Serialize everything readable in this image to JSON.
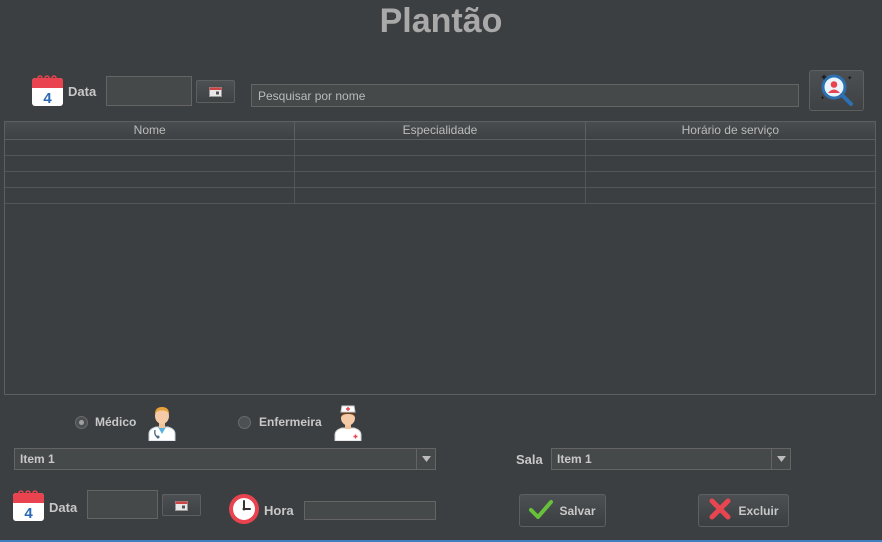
{
  "title": "Plantão",
  "top": {
    "date_label": "Data",
    "date_value": "",
    "search_placeholder": "Pesquisar por nome"
  },
  "table": {
    "columns": [
      "Nome",
      "Especialidade",
      "Horário de serviço"
    ],
    "rows": [
      [
        "",
        "",
        ""
      ],
      [
        "",
        "",
        ""
      ],
      [
        "",
        "",
        ""
      ],
      [
        "",
        "",
        ""
      ]
    ]
  },
  "role": {
    "options": [
      {
        "label": "Médico",
        "selected": true
      },
      {
        "label": "Enfermeira",
        "selected": false
      }
    ]
  },
  "person_select": {
    "value": "Item 1"
  },
  "sala": {
    "label": "Sala",
    "value": "Item 1"
  },
  "bottom": {
    "date_label": "Data",
    "date_value": "",
    "hora_label": "Hora",
    "hora_value": "",
    "save_label": "Salvar",
    "delete_label": "Excluir"
  },
  "colors": {
    "background": "#3c3f41",
    "calendar_red": "#e8434f",
    "calendar_blue": "#2a6ab5",
    "save_green": "#67c23a",
    "delete_red": "#e84552",
    "focus_blue": "#3d7fc1"
  },
  "icons": [
    "calendar-icon",
    "date-picker-icon",
    "search-user-icon",
    "doctor-icon",
    "nurse-icon",
    "dropdown-arrow-icon",
    "clock-icon",
    "check-icon",
    "x-icon"
  ]
}
